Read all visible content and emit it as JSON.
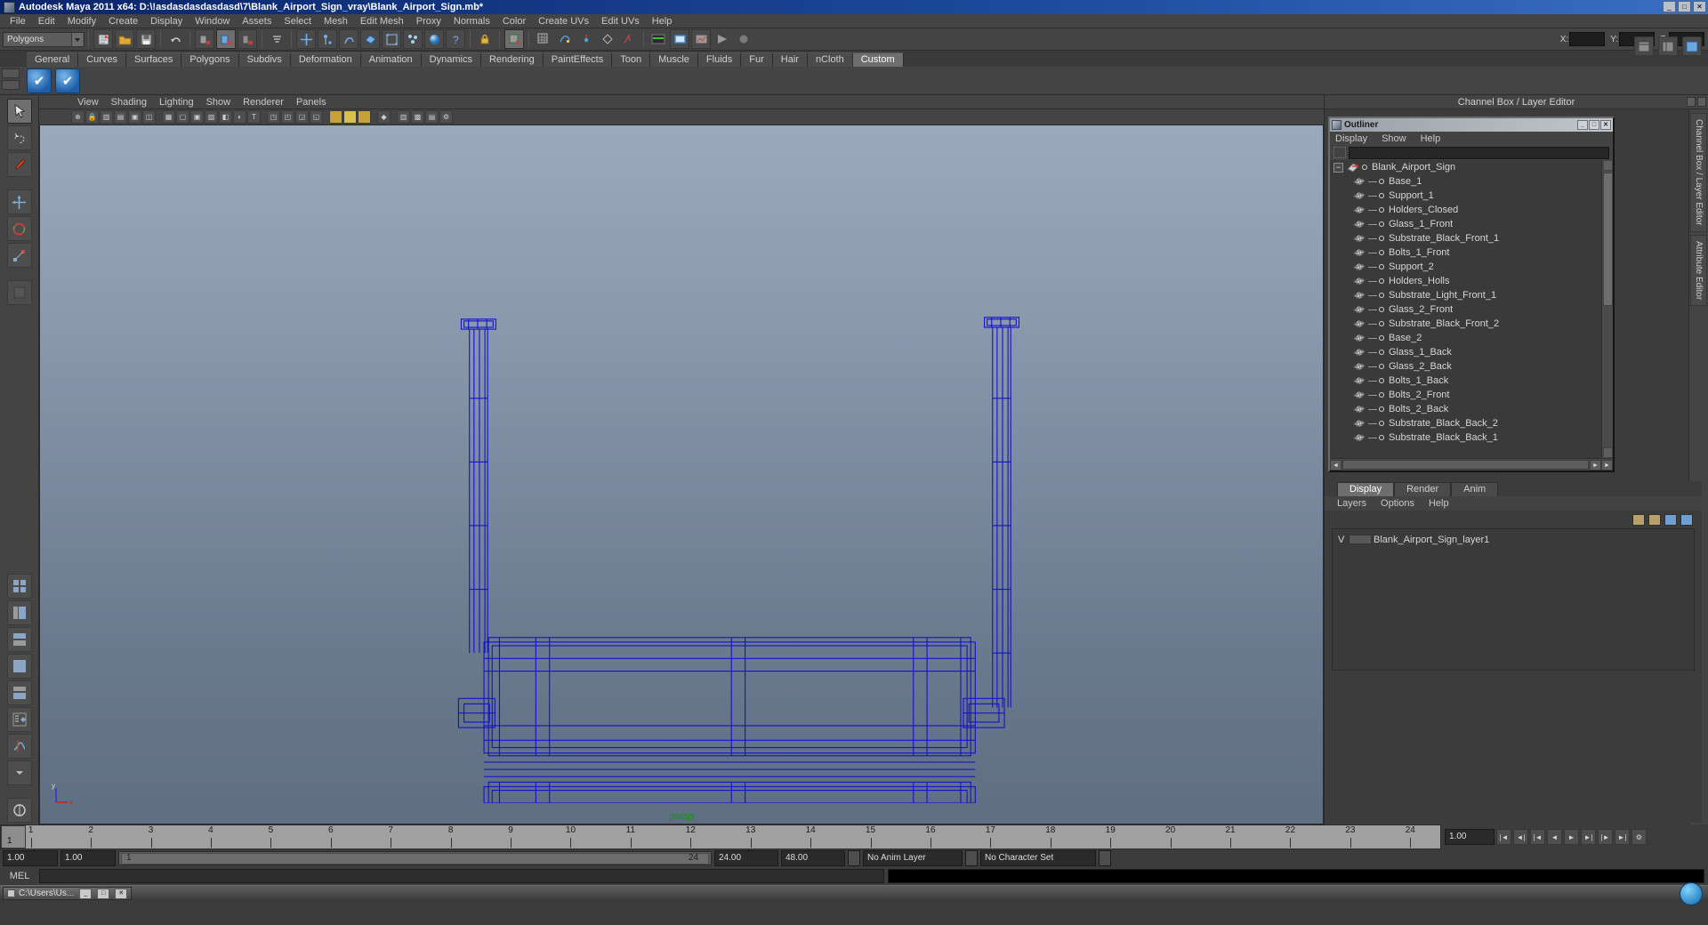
{
  "window": {
    "title": "Autodesk Maya 2011 x64: D:\\!asdasdasdasdasd\\7\\Blank_Airport_Sign_vray\\Blank_Airport_Sign.mb*",
    "minimize": "_",
    "maximize": "□",
    "close": "✕",
    "app_icon": "maya-icon"
  },
  "menubar": {
    "items": [
      "File",
      "Edit",
      "Modify",
      "Create",
      "Display",
      "Window",
      "Assets",
      "Select",
      "Mesh",
      "Edit Mesh",
      "Proxy",
      "Normals",
      "Color",
      "Create UVs",
      "Edit UVs",
      "Help"
    ]
  },
  "statusline": {
    "mode_selector": "Polygons",
    "coord_labels": {
      "x": "X:",
      "y": "Y:",
      "z": "Z:"
    },
    "coord_values": {
      "x": "",
      "y": "",
      "z": ""
    }
  },
  "shelf": {
    "tabs": [
      "General",
      "Curves",
      "Surfaces",
      "Polygons",
      "Subdivs",
      "Deformation",
      "Animation",
      "Dynamics",
      "Rendering",
      "PaintEffects",
      "Toon",
      "Muscle",
      "Fluids",
      "Fur",
      "Hair",
      "nCloth",
      "Custom"
    ],
    "active_tab": "Custom",
    "buttons": [
      "shelf-check-1",
      "shelf-check-2"
    ]
  },
  "viewport": {
    "panel_menus": [
      "View",
      "Shading",
      "Lighting",
      "Show",
      "Renderer",
      "Panels"
    ],
    "camera_label": "persp",
    "axis_labels": {
      "y": "y",
      "x": "x"
    },
    "wire_color": "#1414c8",
    "background_top": "#9aa9bd",
    "background_bottom": "#5f6e82"
  },
  "channelbox": {
    "header": "Channel Box / Layer Editor",
    "vertical_tabs": [
      "Channel Box / Layer Editor",
      "Attribute Editor"
    ]
  },
  "outliner": {
    "title": "Outliner",
    "menus": [
      "Display",
      "Show",
      "Help"
    ],
    "search_value": "",
    "search_placeholder": "",
    "window_buttons": [
      "_",
      "□",
      "✕"
    ],
    "items": [
      {
        "label": "Blank_Airport_Sign",
        "root": true
      },
      {
        "label": "Base_1",
        "root": false
      },
      {
        "label": "Support_1",
        "root": false
      },
      {
        "label": "Holders_Closed",
        "root": false
      },
      {
        "label": "Glass_1_Front",
        "root": false
      },
      {
        "label": "Substrate_Black_Front_1",
        "root": false
      },
      {
        "label": "Bolts_1_Front",
        "root": false
      },
      {
        "label": "Support_2",
        "root": false
      },
      {
        "label": "Holders_Holls",
        "root": false
      },
      {
        "label": "Substrate_Light_Front_1",
        "root": false
      },
      {
        "label": "Glass_2_Front",
        "root": false
      },
      {
        "label": "Substrate_Black_Front_2",
        "root": false
      },
      {
        "label": "Base_2",
        "root": false
      },
      {
        "label": "Glass_1_Back",
        "root": false
      },
      {
        "label": "Glass_2_Back",
        "root": false
      },
      {
        "label": "Bolts_1_Back",
        "root": false
      },
      {
        "label": "Bolts_2_Front",
        "root": false
      },
      {
        "label": "Bolts_2_Back",
        "root": false
      },
      {
        "label": "Substrate_Black_Back_2",
        "root": false
      },
      {
        "label": "Substrate_Black_Back_1",
        "root": false
      }
    ]
  },
  "layereditor": {
    "tabs": [
      "Display",
      "Render",
      "Anim"
    ],
    "active_tab": "Display",
    "menus": [
      "Layers",
      "Options",
      "Help"
    ],
    "rows": [
      {
        "visibility": "V",
        "name": "Blank_Airport_Sign_layer1"
      }
    ]
  },
  "timeline": {
    "ticks": [
      "1",
      "2",
      "3",
      "4",
      "5",
      "6",
      "7",
      "8",
      "9",
      "10",
      "11",
      "12",
      "13",
      "14",
      "15",
      "16",
      "17",
      "18",
      "19",
      "20",
      "21",
      "22",
      "23",
      "24"
    ],
    "current_frame": "1",
    "current_time_field": "1.00",
    "playback_buttons": [
      "go-to-start",
      "step-back-key",
      "step-back-frame",
      "play-backwards",
      "play-forwards",
      "step-forward-frame",
      "step-forward-key",
      "go-to-end"
    ]
  },
  "rangeslider": {
    "anim_start": "1.00",
    "range_start": "1.00",
    "bar_start": "1",
    "bar_end": "24",
    "range_end": "24.00",
    "anim_end": "48.00",
    "anim_layer": "No Anim Layer",
    "character_set": "No Character Set"
  },
  "command": {
    "label": "MEL",
    "input_value": "",
    "output_value": ""
  },
  "taskbar": {
    "item_label": "C:\\Users\\Us...",
    "buttons": [
      "_",
      "□",
      "✕"
    ]
  }
}
